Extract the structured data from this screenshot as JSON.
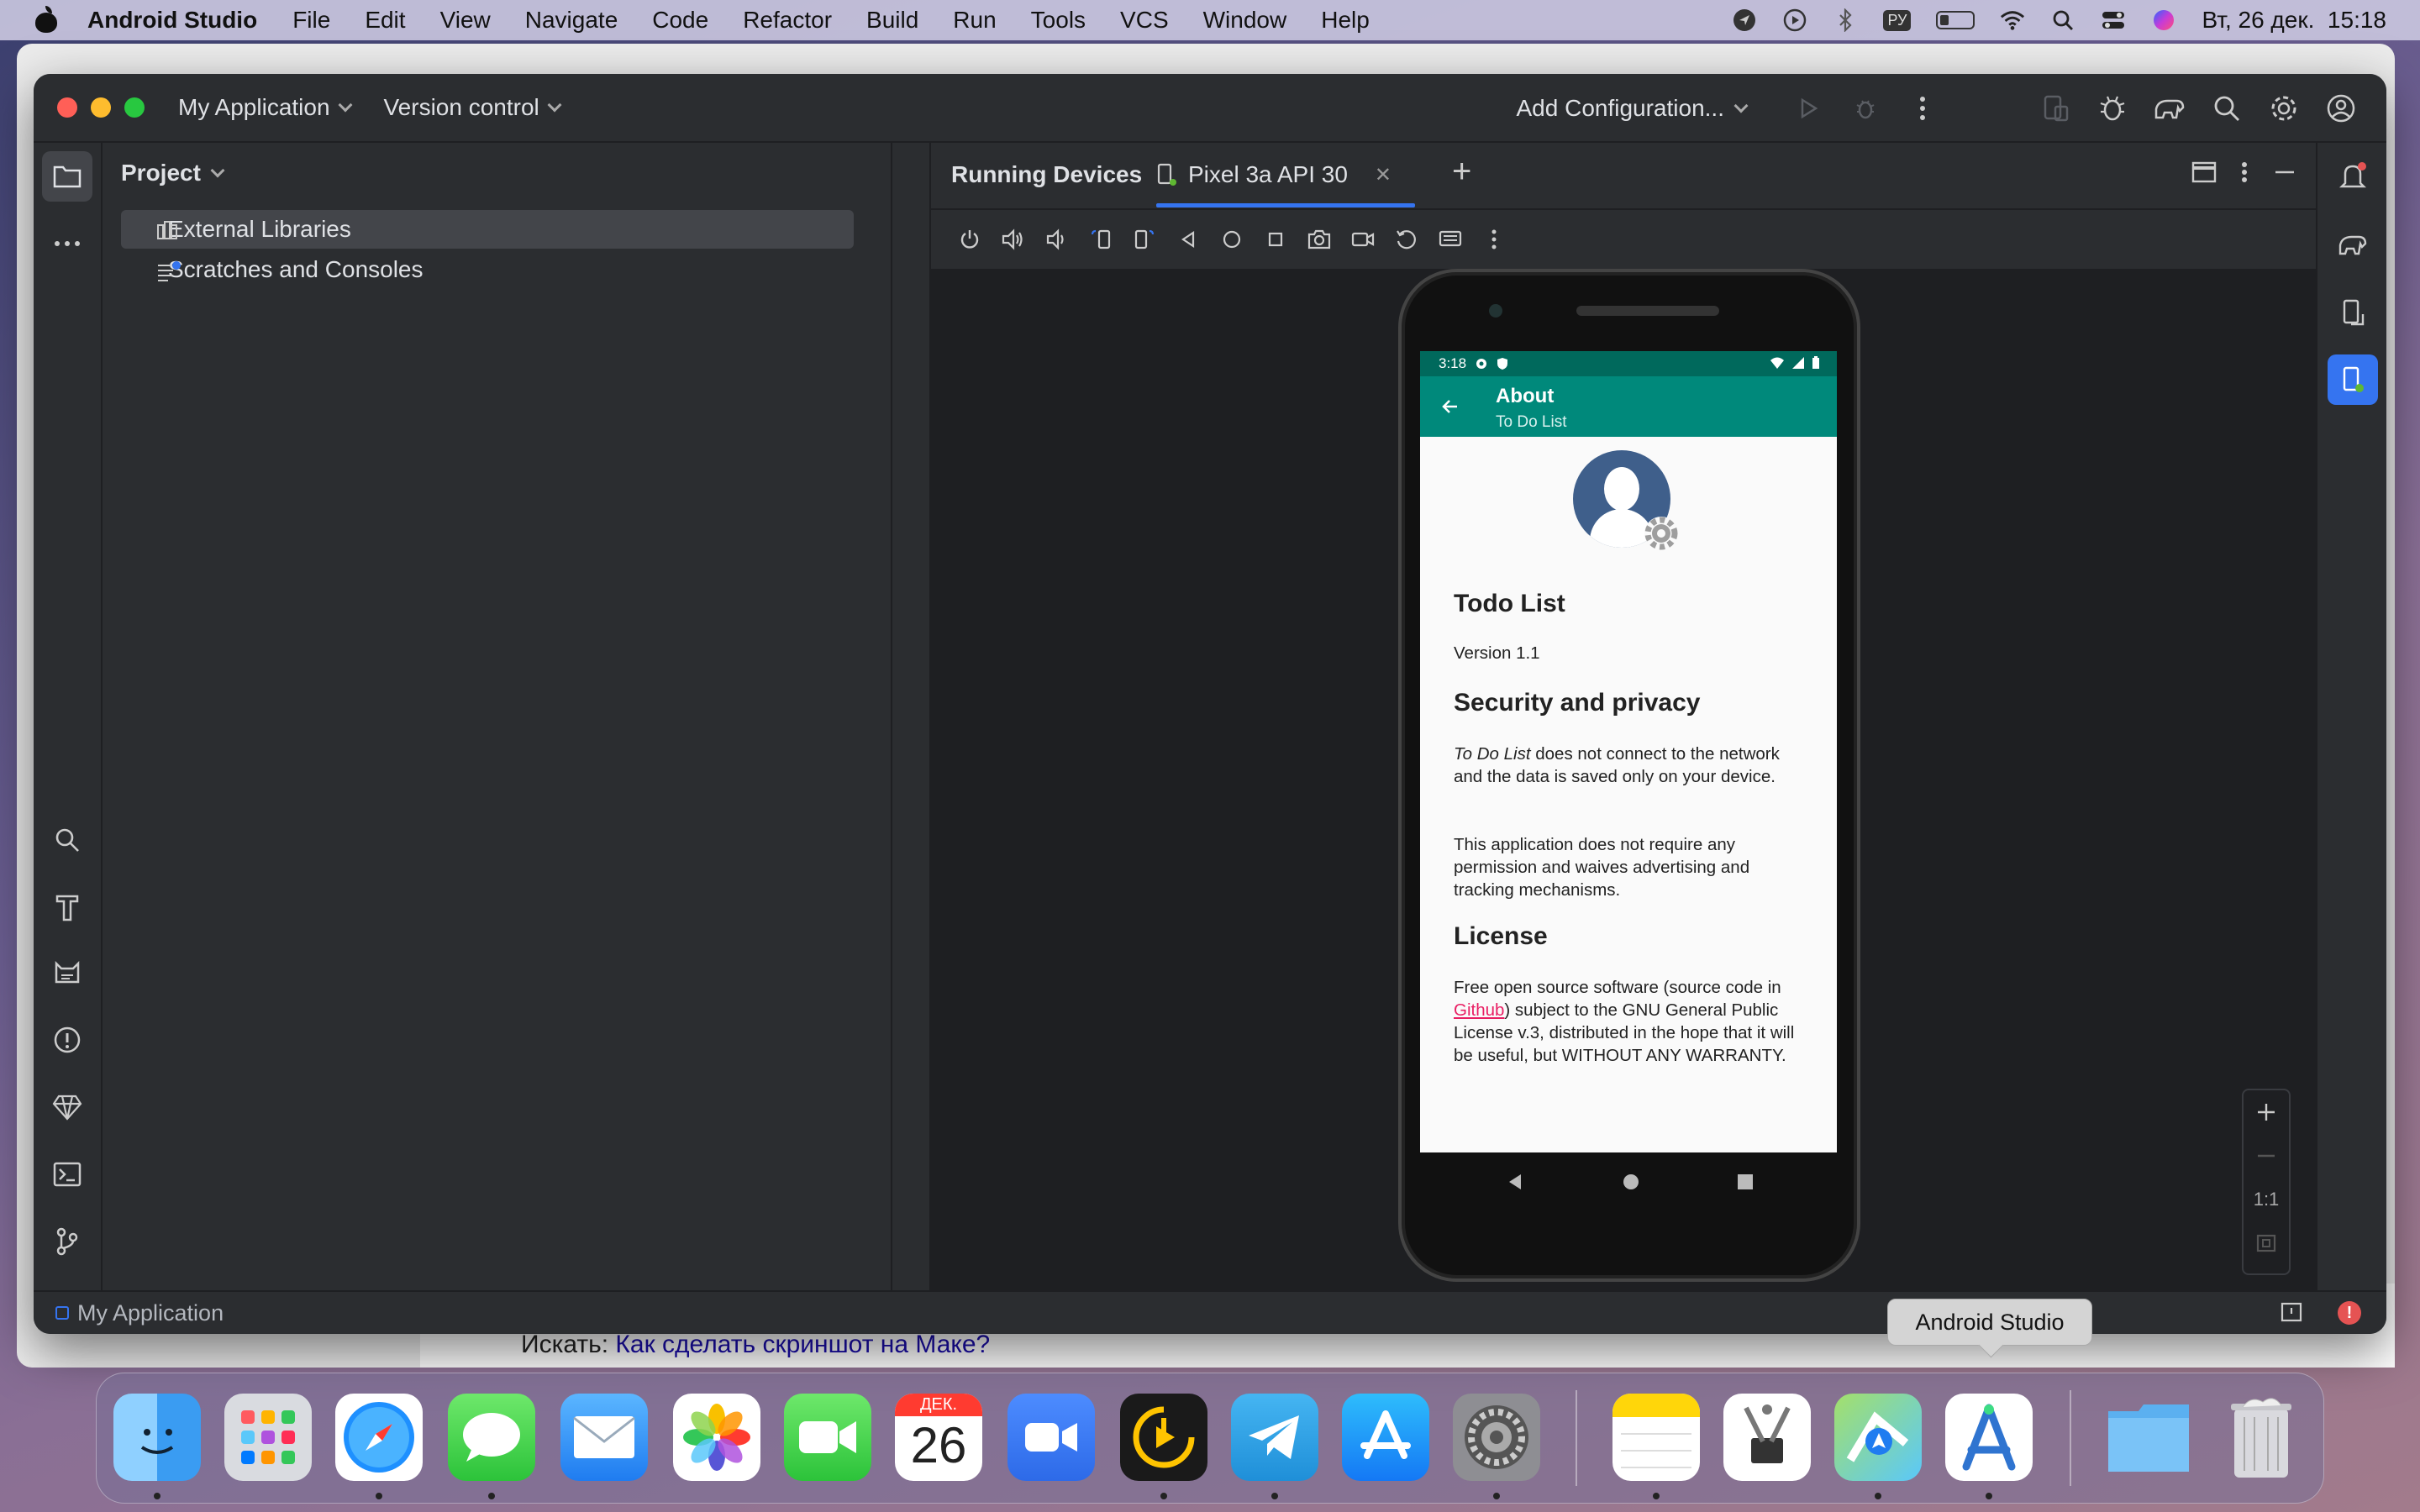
{
  "menubar": {
    "app_name": "Android Studio",
    "items": [
      "File",
      "Edit",
      "View",
      "Navigate",
      "Code",
      "Refactor",
      "Build",
      "Run",
      "Tools",
      "VCS",
      "Window",
      "Help"
    ],
    "keyboard_layout": "РУ",
    "datetime": "Вт, 26 дек.  15:18"
  },
  "background_window": {
    "search_prefix": "Искать:",
    "search_query": "Как сделать скриншот на Маке?"
  },
  "titlebar": {
    "project": "My Application",
    "vcs": "Version control",
    "run_config": "Add Configuration..."
  },
  "project_panel": {
    "title": "Project",
    "items": [
      {
        "label": "External Libraries",
        "icon": "library-icon",
        "selected": true
      },
      {
        "label": "Scratches and Consoles",
        "icon": "scratches-icon",
        "selected": false
      }
    ]
  },
  "running_devices": {
    "title": "Running Devices",
    "tab_label": "Pixel 3a API 30",
    "zoom_ratio_label": "1:1"
  },
  "device": {
    "status_time": "3:18",
    "appbar_title": "About",
    "appbar_subtitle": "To Do List",
    "app_title": "Todo List",
    "version": "Version 1.1",
    "security_heading": "Security and privacy",
    "security_p1_italic": "To Do List",
    "security_p1_rest": " does not connect to the network and the data is saved only on your device.",
    "security_p2": "This application does not require any permission and waives advertising and tracking mechanisms.",
    "license_heading": "License",
    "license_p_before": "Free open source software (source code in ",
    "license_link": "Github",
    "license_p_after": ") subject to the GNU General Public License v.3, distributed in the hope that it will be useful, but WITHOUT ANY WARRANTY."
  },
  "statusbar": {
    "project_label": "My Application"
  },
  "tooltip": {
    "label": "Android Studio"
  },
  "dock": {
    "calendar_month": "ДЕК.",
    "calendar_day": "26"
  },
  "colors": {
    "ide_bg": "#2b2d30",
    "accent": "#3574f0",
    "android_primary": "#00897b",
    "android_dark": "#00695c",
    "link": "#e91e63"
  }
}
